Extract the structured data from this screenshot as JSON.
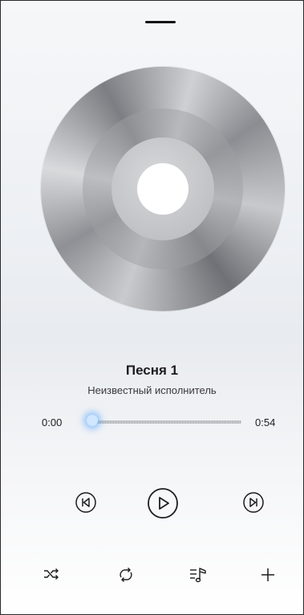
{
  "player": {
    "title": "Песня 1",
    "artist": "Неизвестный исполнитель",
    "time_elapsed": "0:00",
    "time_total": "0:54",
    "progress": 0.0
  },
  "controls": {
    "previous_icon": "skip-previous-icon",
    "play_icon": "play-icon",
    "next_icon": "skip-next-icon",
    "shuffle_icon": "shuffle-icon",
    "repeat_icon": "repeat-icon",
    "playlist_icon": "playlist-music-icon",
    "add_icon": "add-icon"
  },
  "colors": {
    "accent": "#3aa0ff",
    "text": "#1d1d1f"
  }
}
